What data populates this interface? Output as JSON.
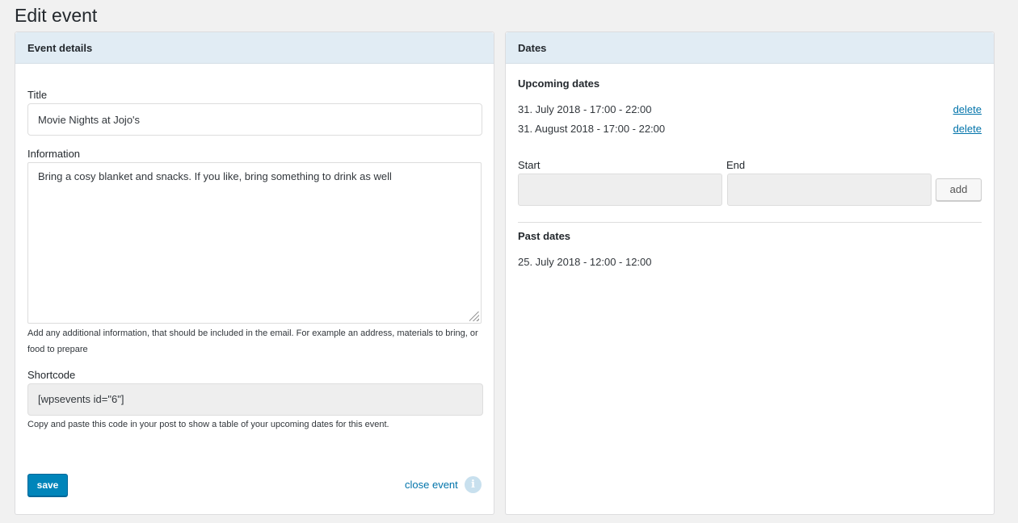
{
  "page": {
    "title": "Edit event"
  },
  "event_details": {
    "header": "Event details",
    "title_label": "Title",
    "title_value": "Movie Nights at Jojo's",
    "information_label": "Information",
    "information_value": "Bring a cosy blanket and snacks. If you like, bring something to drink as well",
    "information_help": "Add any additional information, that should be included in the email. For example an address, materials to bring, or food to prepare",
    "shortcode_label": "Shortcode",
    "shortcode_value": "[wpsevents id=\"6\"]",
    "shortcode_help": "Copy and paste this code in your post to show a table of your upcoming dates for this event.",
    "save_label": "save",
    "close_label": "close event",
    "info_icon": "i"
  },
  "dates": {
    "header": "Dates",
    "upcoming_title": "Upcoming dates",
    "upcoming": [
      {
        "text": "31. July 2018 - 17:00 - 22:00",
        "delete_label": "delete"
      },
      {
        "text": "31. August 2018 - 17:00 - 22:00",
        "delete_label": "delete"
      }
    ],
    "start_label": "Start",
    "end_label": "End",
    "start_value": "",
    "end_value": "",
    "add_label": "add",
    "past_title": "Past dates",
    "past": [
      {
        "text": "25. July 2018 - 12:00 - 12:00"
      }
    ]
  },
  "colors": {
    "background": "#f1f1f1",
    "panel_header": "#e1ecf4",
    "primary_button": "#0085ba",
    "link": "#0073aa"
  }
}
